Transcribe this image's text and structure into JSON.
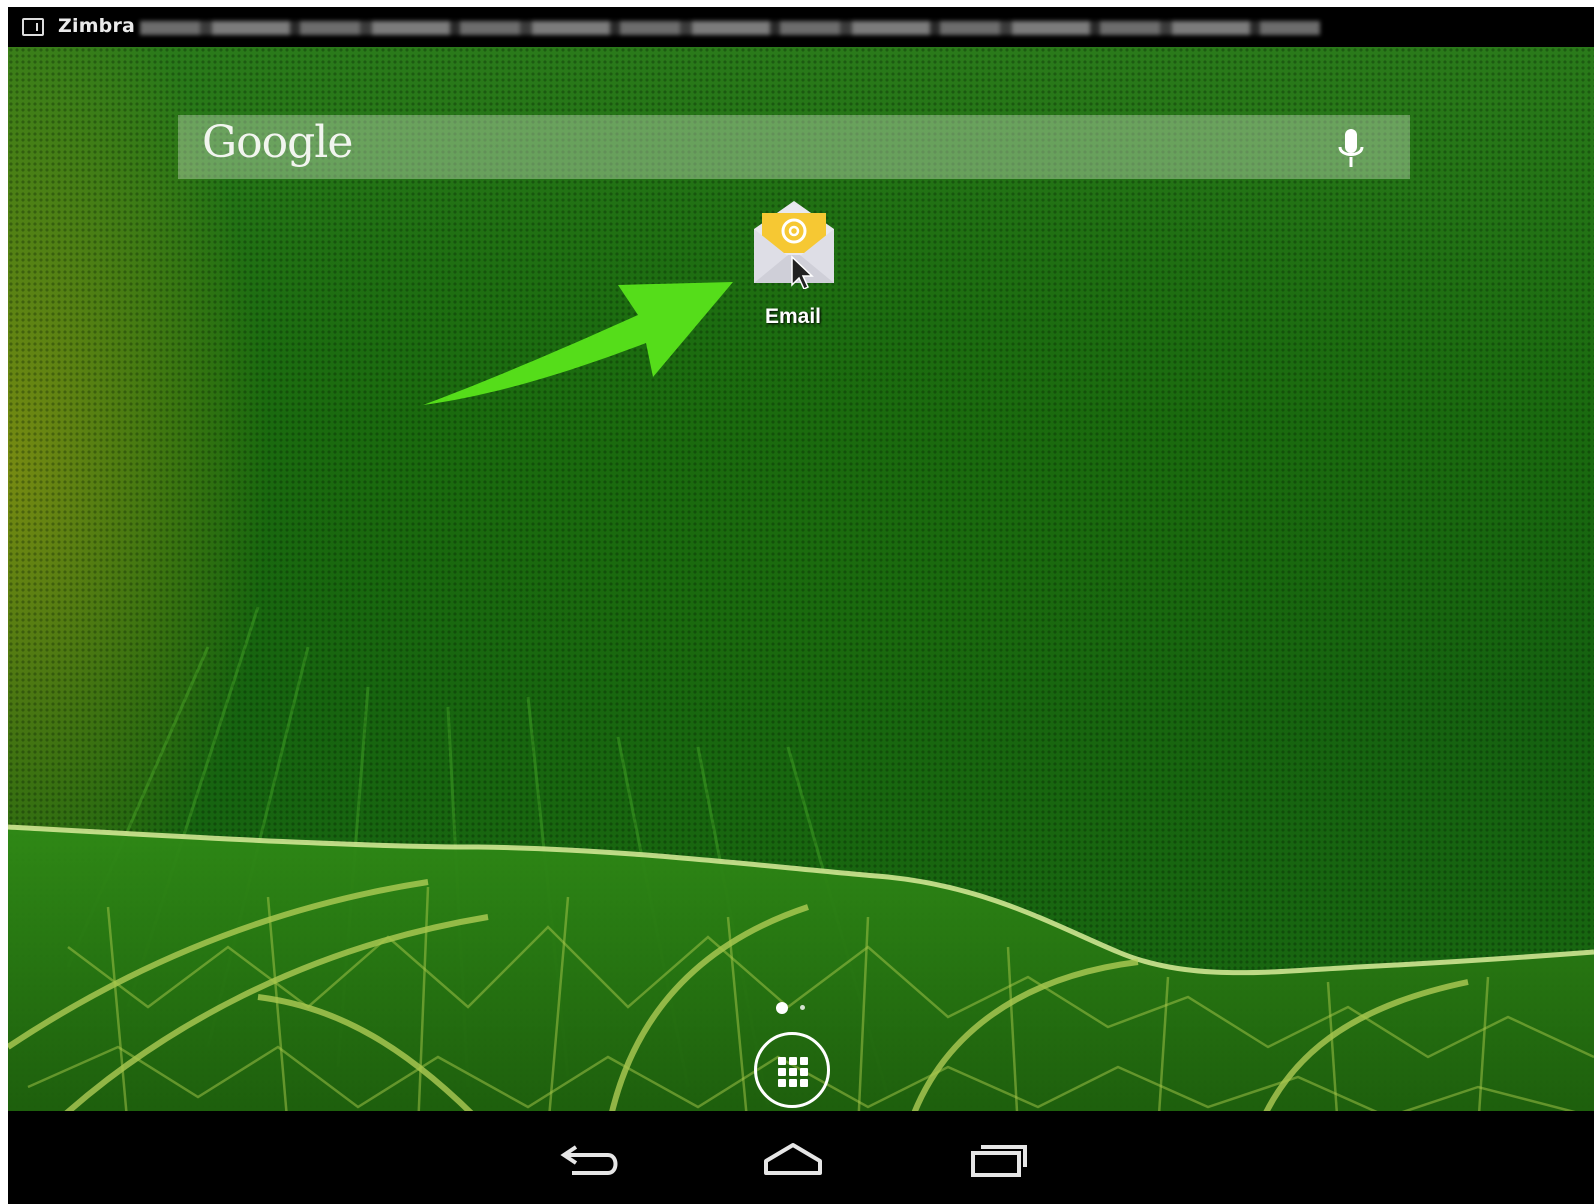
{
  "status_bar": {
    "notification_title": "Zimbra",
    "notification_icon": "calendar-icon"
  },
  "search_widget": {
    "logo_text": "Google",
    "mic_icon": "mic-icon"
  },
  "home_screen": {
    "apps": [
      {
        "label": "Email",
        "icon": "email-envelope-icon"
      }
    ],
    "pages": 2,
    "current_page": 1
  },
  "dock": {
    "all_apps_icon": "app-drawer-icon"
  },
  "navigation_bar": {
    "back_icon": "back-icon",
    "home_icon": "home-icon",
    "recents_icon": "recent-apps-icon"
  },
  "colors": {
    "annotation_arrow": "#55dd1a",
    "wallpaper_primary": "#1a6a0f",
    "email_envelope": "#f2c12e"
  }
}
